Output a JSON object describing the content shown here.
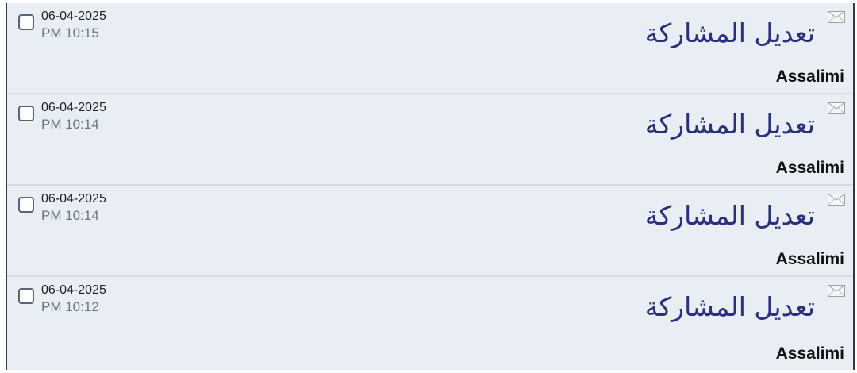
{
  "posts": [
    {
      "title": "تعديل المشاركة",
      "author": "Assalimi",
      "date": "06-04-2025",
      "time": "PM 10:15",
      "icon": "envelope-icon"
    },
    {
      "title": "تعديل المشاركة",
      "author": "Assalimi",
      "date": "06-04-2025",
      "time": "PM 10:14",
      "icon": "envelope-icon"
    },
    {
      "title": "تعديل المشاركة",
      "author": "Assalimi",
      "date": "06-04-2025",
      "time": "PM 10:14",
      "icon": "envelope-icon"
    },
    {
      "title": "تعديل المشاركة",
      "author": "Assalimi",
      "date": "06-04-2025",
      "time": "PM 10:12",
      "icon": "envelope-icon"
    }
  ],
  "colors": {
    "row_background": "#e9eef4",
    "title": "#2b2f7e",
    "time": "#6b7680"
  }
}
